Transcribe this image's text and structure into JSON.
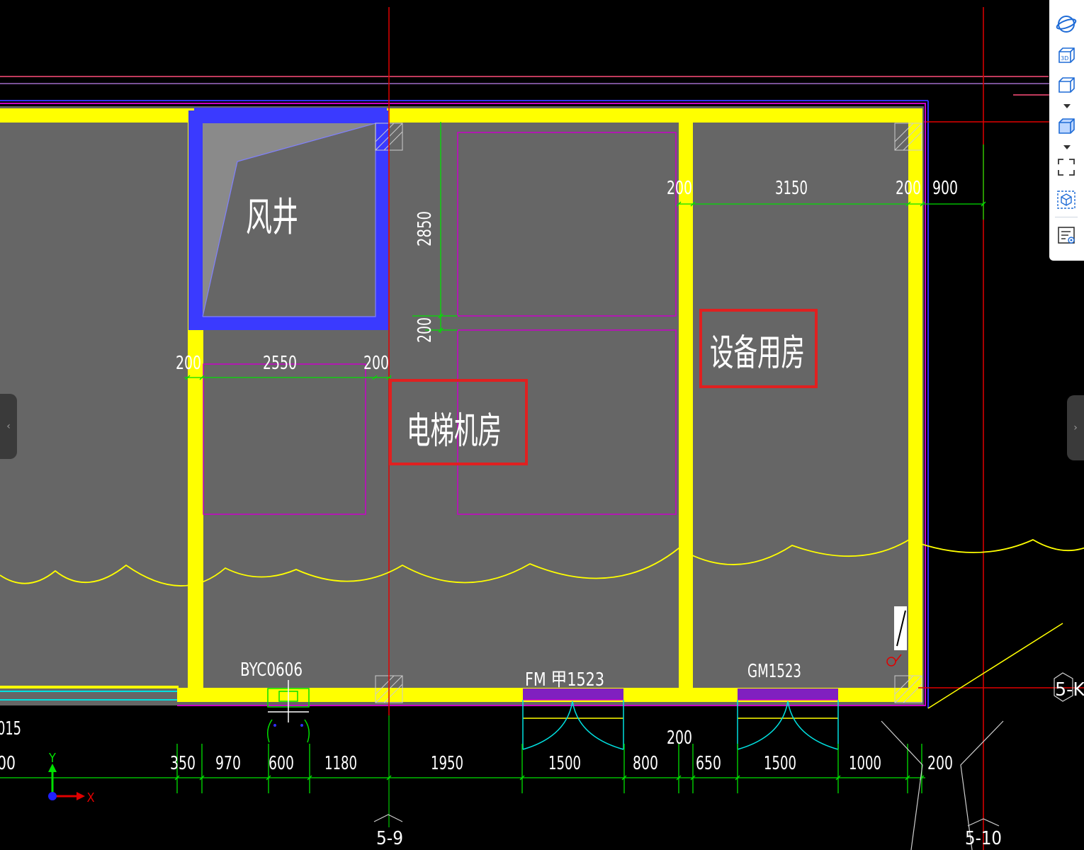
{
  "rooms": {
    "air_shaft": "风井",
    "elevator_machine_room": "电梯机房",
    "equipment_room": "设备用房"
  },
  "dims": {
    "top_right": [
      "200",
      "3150",
      "200",
      "900"
    ],
    "shaft_bottom": [
      "200",
      "2550",
      "200"
    ],
    "vertical": [
      "2850",
      "200"
    ],
    "bottom_row": [
      "00",
      "350",
      "970",
      "600",
      "1180",
      "1950",
      "1500",
      "800",
      "200",
      "650",
      "1500",
      "1000",
      "200"
    ],
    "edge_015": "015"
  },
  "openings": {
    "window": "BYC0606",
    "fire_door": "FM 甲1523",
    "door": "GM1523"
  },
  "axes": {
    "axis_left": "5-9",
    "axis_right": "5-10",
    "axis_row": "5-K"
  },
  "ucs": {
    "x": "X",
    "y": "Y"
  },
  "toolbar": {
    "items": [
      "orbit-icon",
      "view-3d-icon",
      "box-view-icon",
      "shaded-box-icon",
      "fit-view-icon",
      "cube-select-icon",
      "properties-list-icon"
    ]
  },
  "colors": {
    "background": "#000000",
    "floor": "#666666",
    "wall": "#ffff00",
    "shaft_wall": "#3a3aff",
    "dimension": "#00e000",
    "grid": "#e00000",
    "magenta": "#c800c8",
    "highlight": "#e02020"
  }
}
